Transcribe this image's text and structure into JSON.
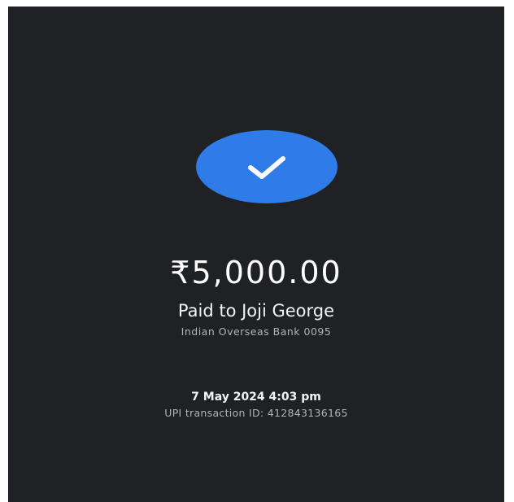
{
  "payment": {
    "status_icon": "check-icon",
    "accent_color": "#2f7ce8",
    "amount": "₹5,000.00",
    "paid_to": "Paid to Joji George",
    "bank": "Indian Overseas Bank 0095",
    "datetime": "7 May 2024 4:03 pm",
    "transaction_id": "UPI transaction ID: 412843136165"
  }
}
